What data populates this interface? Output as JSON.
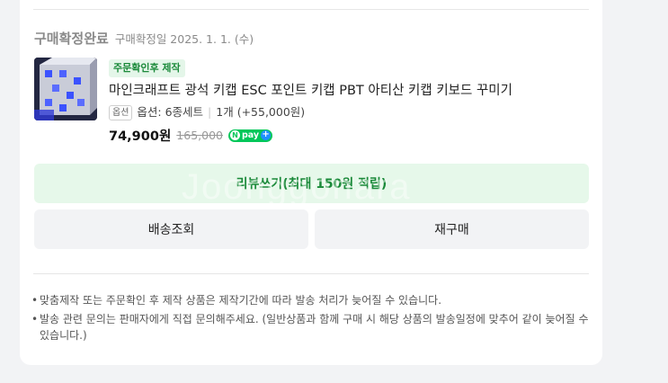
{
  "order": {
    "status_title": "구매확정완료",
    "status_date": "구매확정일 2025. 1. 1. (수)"
  },
  "product": {
    "tag": "주문확인후 제작",
    "name": "마인크래프트 광석 키캡 ESC 포인트 키캡 PBT 아티산 키캡 키보드 꾸미기",
    "option_chip": "옵션",
    "option_text": "옵션: 6종세트",
    "quantity_text": "1개 (+55,000원)",
    "price": "74,900원",
    "original_price": "165,000",
    "npay_label": "pay"
  },
  "buttons": {
    "review": "리뷰쓰기(최대 150원 적립)",
    "track_shipping": "배송조회",
    "reorder": "재구매"
  },
  "notices": [
    "맞춤제작 또는 주문확인 후 제작 상품은 제작기간에 따라 발송 처리가 늦어질 수 있습니다.",
    "발송 관련 문의는 판매자에게 직접 문의해주세요. (일반상품과 함께 구매 시 해당 상품의 발송일정에 맞추어 같이 늦어질 수 있습니다.)"
  ],
  "watermark": "Joonggonara",
  "colors": {
    "accent_green": "#1b8a3a",
    "review_bg": "#e6f8ea",
    "npay_green": "#03c75a"
  }
}
